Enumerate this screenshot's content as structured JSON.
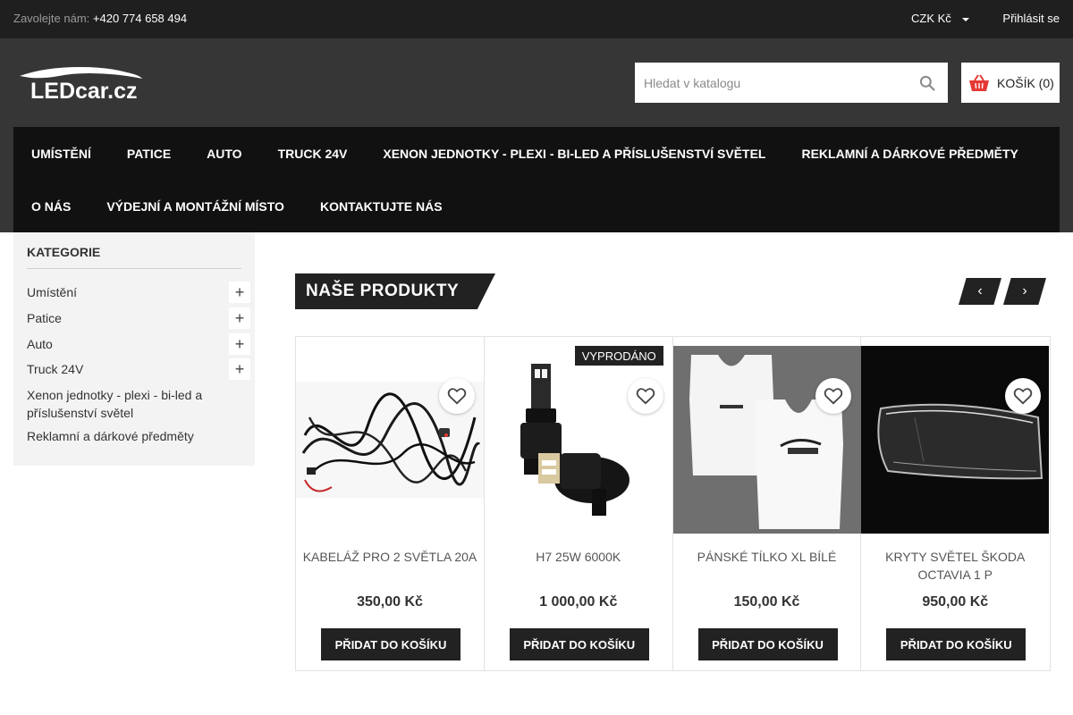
{
  "topbar": {
    "contact_label": "Zavolejte nám:",
    "phone": "+420 774 658 494",
    "currency": "CZK Kč",
    "login": "Přihlásit se"
  },
  "header": {
    "logo_text": "LEDcar.cz",
    "search_placeholder": "Hledat v katalogu",
    "cart_label": "KOŠÍK (0)"
  },
  "nav": {
    "items": [
      "UMÍSTĚNÍ",
      "PATICE",
      "AUTO",
      "TRUCK 24V",
      "XENON JEDNOTKY - PLEXI - BI-LED A PŘÍSLUŠENSTVÍ SVĚTEL",
      "REKLAMNÍ A DÁRKOVÉ PŘEDMĚTY",
      "O NÁS",
      "VÝDEJNÍ A MONTÁŽNÍ MÍSTO",
      "KONTAKTUJTE NÁS"
    ]
  },
  "sidebar": {
    "title": "KATEGORIE",
    "categories": [
      {
        "label": "Umístění",
        "expandable": true
      },
      {
        "label": "Patice",
        "expandable": true
      },
      {
        "label": "Auto",
        "expandable": true
      },
      {
        "label": "Truck 24V",
        "expandable": true
      },
      {
        "label": "Xenon jednotky - plexi - bi-led a příslušenství světel",
        "expandable": false
      },
      {
        "label": "Reklamní a dárkové předměty",
        "expandable": false
      }
    ]
  },
  "products_section": {
    "title": "NAŠE PRODUKTY",
    "products": [
      {
        "name": "KABELÁŽ PRO 2 SVĚTLA 20A",
        "price": "350,00 Kč",
        "button": "PŘIDAT DO KOŠÍKU",
        "badge": ""
      },
      {
        "name": "H7 25W 6000K",
        "price": "1 000,00 Kč",
        "button": "PŘIDAT DO KOŠÍKU",
        "badge": "VYPRODÁNO"
      },
      {
        "name": "PÁNSKÉ TÍLKO XL BÍLÉ",
        "price": "150,00 Kč",
        "button": "PŘIDAT DO KOŠÍKU",
        "badge": ""
      },
      {
        "name": "KRYTY SVĚTEL ŠKODA OCTAVIA 1 P",
        "price": "950,00 Kč",
        "button": "PŘIDAT DO KOŠÍKU",
        "badge": ""
      }
    ]
  },
  "colors": {
    "topbar_bg": "#1f1f1f",
    "header_bg": "#363636",
    "nav_bg": "#111111",
    "accent_dark": "#222222",
    "cart_icon": "#e53935"
  },
  "icons": {
    "search": "search-icon",
    "cart": "basket-icon",
    "favorite": "heart-icon",
    "prev": "chevron-left-icon",
    "next": "chevron-right-icon",
    "expand": "plus-icon",
    "currency_caret": "caret-down-icon"
  }
}
